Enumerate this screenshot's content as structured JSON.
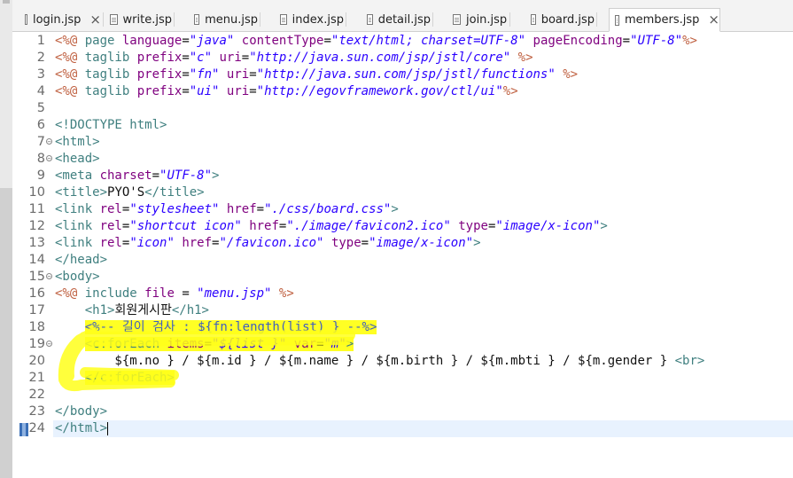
{
  "tabs": [
    {
      "label": "login.jsp",
      "active": false,
      "closable": true
    },
    {
      "label": "write.jsp",
      "active": false,
      "closable": false
    },
    {
      "label": "menu.jsp",
      "active": false,
      "closable": false
    },
    {
      "label": "index.jsp",
      "active": false,
      "closable": false
    },
    {
      "label": "detail.jsp",
      "active": false,
      "closable": false
    },
    {
      "label": "join.jsp",
      "active": false,
      "closable": false
    },
    {
      "label": "board.jsp",
      "active": false,
      "closable": false
    },
    {
      "label": "members.jsp",
      "active": true,
      "closable": true
    }
  ],
  "editor": {
    "current_line": 24,
    "highlight_color": "#ffff24",
    "lines": [
      {
        "n": "1",
        "fold": false,
        "segs": [
          [
            "d",
            "<%@ "
          ],
          [
            "kw",
            "page "
          ],
          [
            "at",
            "language"
          ],
          [
            "pl",
            "="
          ],
          [
            "str",
            "\"java\""
          ],
          [
            "pl",
            " "
          ],
          [
            "at",
            "contentType"
          ],
          [
            "pl",
            "="
          ],
          [
            "str",
            "\"text/html; charset=UTF-8\""
          ],
          [
            "pl",
            " "
          ],
          [
            "at",
            "pageEncoding"
          ],
          [
            "pl",
            "="
          ],
          [
            "str",
            "\"UTF-8\""
          ],
          [
            "d",
            "%>"
          ]
        ]
      },
      {
        "n": "2",
        "fold": false,
        "segs": [
          [
            "d",
            "<%@ "
          ],
          [
            "kw",
            "taglib "
          ],
          [
            "at",
            "prefix"
          ],
          [
            "pl",
            "="
          ],
          [
            "str",
            "\"c\""
          ],
          [
            "pl",
            " "
          ],
          [
            "at",
            "uri"
          ],
          [
            "pl",
            "="
          ],
          [
            "str",
            "\"http://java.sun.com/jsp/jstl/core\""
          ],
          [
            "pl",
            " "
          ],
          [
            "d",
            "%>"
          ]
        ]
      },
      {
        "n": "3",
        "fold": false,
        "segs": [
          [
            "d",
            "<%@ "
          ],
          [
            "kw",
            "taglib "
          ],
          [
            "at",
            "prefix"
          ],
          [
            "pl",
            "="
          ],
          [
            "str",
            "\"fn\""
          ],
          [
            "pl",
            " "
          ],
          [
            "at",
            "uri"
          ],
          [
            "pl",
            "="
          ],
          [
            "str",
            "\"http://java.sun.com/jsp/jstl/functions\""
          ],
          [
            "pl",
            " "
          ],
          [
            "d",
            "%>"
          ]
        ]
      },
      {
        "n": "4",
        "fold": false,
        "segs": [
          [
            "d",
            "<%@ "
          ],
          [
            "kw",
            "taglib "
          ],
          [
            "at",
            "prefix"
          ],
          [
            "pl",
            "="
          ],
          [
            "str",
            "\"ui\""
          ],
          [
            "pl",
            " "
          ],
          [
            "at",
            "uri"
          ],
          [
            "pl",
            "="
          ],
          [
            "str",
            "\"http://egovframework.gov/ctl/ui\""
          ],
          [
            "d",
            "%>"
          ]
        ]
      },
      {
        "n": "5",
        "fold": false,
        "segs": []
      },
      {
        "n": "6",
        "fold": false,
        "segs": [
          [
            "kw",
            "<!DOCTYPE html>"
          ]
        ]
      },
      {
        "n": "7",
        "fold": true,
        "segs": [
          [
            "kw",
            "<html>"
          ]
        ]
      },
      {
        "n": "8",
        "fold": true,
        "segs": [
          [
            "kw",
            "<head>"
          ]
        ]
      },
      {
        "n": "9",
        "fold": false,
        "segs": [
          [
            "kw",
            "<meta "
          ],
          [
            "at",
            "charset"
          ],
          [
            "pl",
            "="
          ],
          [
            "str",
            "\"UTF-8\""
          ],
          [
            "kw",
            ">"
          ]
        ]
      },
      {
        "n": "10",
        "fold": false,
        "segs": [
          [
            "kw",
            "<title>"
          ],
          [
            "pl",
            "PYO'S"
          ],
          [
            "kw",
            "</title>"
          ]
        ]
      },
      {
        "n": "11",
        "fold": false,
        "segs": [
          [
            "kw",
            "<link "
          ],
          [
            "at",
            "rel"
          ],
          [
            "pl",
            "="
          ],
          [
            "str",
            "\"stylesheet\""
          ],
          [
            "pl",
            " "
          ],
          [
            "at",
            "href"
          ],
          [
            "pl",
            "="
          ],
          [
            "str",
            "\"./css/board.css\""
          ],
          [
            "kw",
            ">"
          ]
        ]
      },
      {
        "n": "12",
        "fold": false,
        "segs": [
          [
            "kw",
            "<link "
          ],
          [
            "at",
            "rel"
          ],
          [
            "pl",
            "="
          ],
          [
            "str",
            "\"shortcut icon\""
          ],
          [
            "pl",
            " "
          ],
          [
            "at",
            "href"
          ],
          [
            "pl",
            "="
          ],
          [
            "str",
            "\"./image/favicon2.ico\""
          ],
          [
            "pl",
            " "
          ],
          [
            "at",
            "type"
          ],
          [
            "pl",
            "="
          ],
          [
            "str",
            "\"image/x-icon\""
          ],
          [
            "kw",
            ">"
          ]
        ]
      },
      {
        "n": "13",
        "fold": false,
        "segs": [
          [
            "kw",
            "<link "
          ],
          [
            "at",
            "rel"
          ],
          [
            "pl",
            "="
          ],
          [
            "str",
            "\"icon\""
          ],
          [
            "pl",
            " "
          ],
          [
            "at",
            "href"
          ],
          [
            "pl",
            "="
          ],
          [
            "str",
            "\"/favicon.ico\""
          ],
          [
            "pl",
            " "
          ],
          [
            "at",
            "type"
          ],
          [
            "pl",
            "="
          ],
          [
            "str",
            "\"image/x-icon\""
          ],
          [
            "kw",
            ">"
          ]
        ]
      },
      {
        "n": "14",
        "fold": false,
        "segs": [
          [
            "kw",
            "</head>"
          ]
        ]
      },
      {
        "n": "15",
        "fold": true,
        "segs": [
          [
            "kw",
            "<body>"
          ]
        ]
      },
      {
        "n": "16",
        "fold": false,
        "segs": [
          [
            "d",
            "<%@ "
          ],
          [
            "kw",
            "include "
          ],
          [
            "at",
            "file "
          ],
          [
            "pl",
            "= "
          ],
          [
            "str",
            "\"menu.jsp\""
          ],
          [
            "pl",
            " "
          ],
          [
            "d",
            "%>"
          ]
        ]
      },
      {
        "n": "17",
        "fold": false,
        "segs": [
          [
            "pl",
            "    "
          ],
          [
            "kw",
            "<h1>"
          ],
          [
            "pl",
            "회원게시판"
          ],
          [
            "kw",
            "</h1>"
          ]
        ]
      },
      {
        "n": "18",
        "fold": false,
        "segs": [
          [
            "pl",
            "    "
          ],
          [
            "hcm",
            "<%-- 길이 검사 : ${fn:length(list) } --%>"
          ]
        ]
      },
      {
        "n": "19",
        "fold": true,
        "segs": [
          [
            "pl",
            "    "
          ],
          [
            "hkw",
            "<c:forEach "
          ],
          [
            "hat",
            "items"
          ],
          [
            "hpl",
            "="
          ],
          [
            "hstr",
            "\"${list }\""
          ],
          [
            "hpl",
            " "
          ],
          [
            "hat",
            "var"
          ],
          [
            "hpl",
            "="
          ],
          [
            "hstr",
            "\"m\""
          ],
          [
            "hkw",
            ">"
          ]
        ]
      },
      {
        "n": "20",
        "fold": false,
        "segs": [
          [
            "pl",
            "        ${m.no } / ${m.id } / ${m.name } / ${m.birth } / ${m.mbti } / ${m.gender } "
          ],
          [
            "kw",
            "<br>"
          ]
        ]
      },
      {
        "n": "21",
        "fold": false,
        "segs": [
          [
            "pl",
            "    "
          ],
          [
            "hkw",
            "</c:forEach>"
          ]
        ]
      },
      {
        "n": "22",
        "fold": false,
        "segs": []
      },
      {
        "n": "23",
        "fold": false,
        "segs": [
          [
            "kw",
            "</body>"
          ]
        ]
      },
      {
        "n": "24",
        "fold": false,
        "segs": [
          [
            "kw",
            "</html>"
          ],
          [
            "caret",
            ""
          ]
        ]
      }
    ]
  }
}
